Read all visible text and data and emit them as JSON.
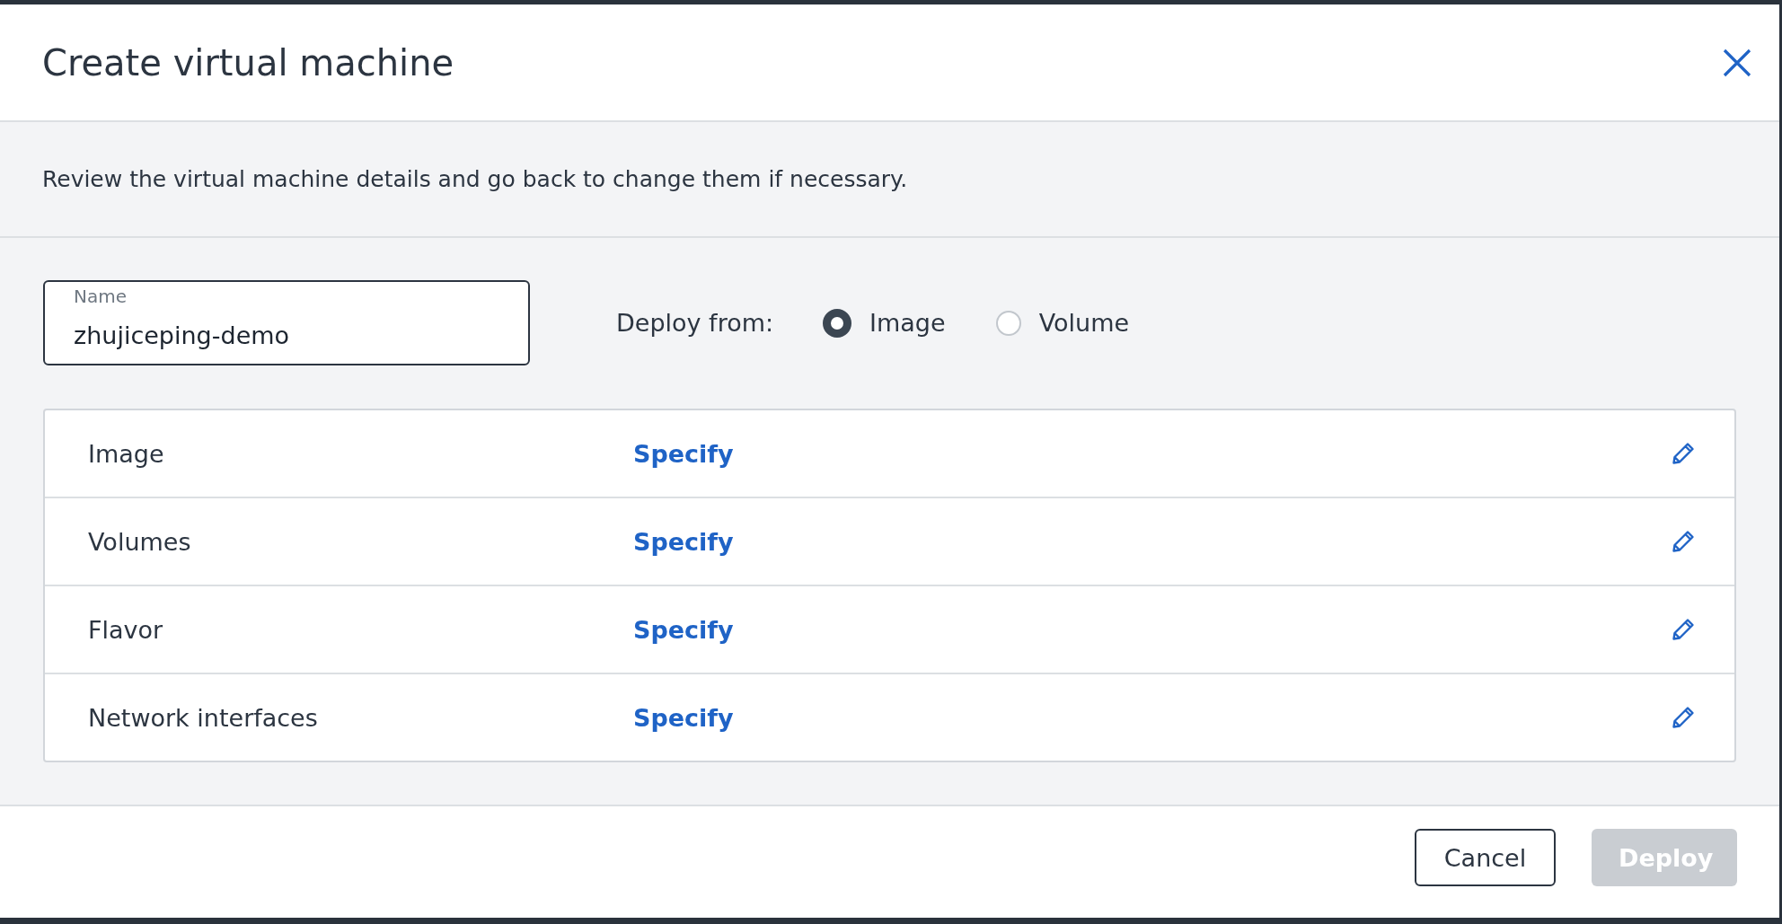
{
  "window": {
    "title": "Create virtual machine"
  },
  "description": "Review the virtual machine details and go back to change them if necessary.",
  "name_field": {
    "label": "Name",
    "value": "zhujiceping-demo"
  },
  "deploy_from": {
    "label": "Deploy from:",
    "options": [
      {
        "label": "Image",
        "selected": true
      },
      {
        "label": "Volume",
        "selected": false
      }
    ]
  },
  "rows": [
    {
      "label": "Image",
      "value": "Specify"
    },
    {
      "label": "Volumes",
      "value": "Specify"
    },
    {
      "label": "Flavor",
      "value": "Specify"
    },
    {
      "label": "Network interfaces",
      "value": "Specify"
    }
  ],
  "buttons": [
    {
      "label": "Cancel",
      "kind": "secondary",
      "disabled": false
    },
    {
      "label": "Deploy",
      "kind": "primary",
      "disabled": true
    }
  ]
}
